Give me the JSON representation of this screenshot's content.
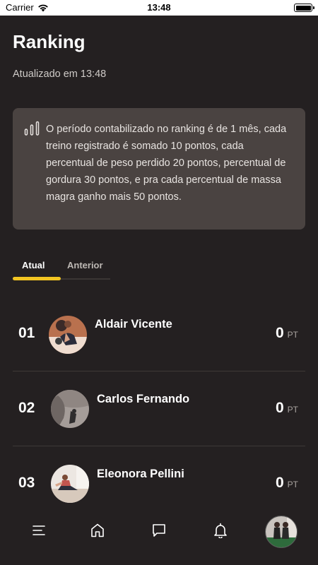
{
  "status_bar": {
    "carrier": "Carrier",
    "time": "13:48"
  },
  "header": {
    "title": "Ranking",
    "updated": "Atualizado em 13:48"
  },
  "info": {
    "icon": "chart-bars-icon",
    "text": "O período contabilizado no ranking é de 1 mês, cada treino registrado é somado 10 pontos, cada percentual de peso perdido 20 pontos, percentual de gordura 30 pontos, e pra cada percentual de massa magra ganho mais 50 pontos."
  },
  "tabs": [
    {
      "label": "Atual",
      "active": true
    },
    {
      "label": "Anterior",
      "active": false
    }
  ],
  "colors": {
    "background": "#242021",
    "card": "#4a4341",
    "accent": "#f2c522"
  },
  "ranking": [
    {
      "position": "01",
      "name": "Aldair Vicente",
      "points": "0",
      "unit": "PT"
    },
    {
      "position": "02",
      "name": "Carlos Fernando",
      "points": "0",
      "unit": "PT"
    },
    {
      "position": "03",
      "name": "Eleonora Pellini",
      "points": "0",
      "unit": "PT"
    }
  ],
  "bottom_nav": [
    {
      "icon": "menu-icon"
    },
    {
      "icon": "home-icon"
    },
    {
      "icon": "chat-icon"
    },
    {
      "icon": "bell-icon"
    },
    {
      "icon": "profile-avatar"
    }
  ]
}
